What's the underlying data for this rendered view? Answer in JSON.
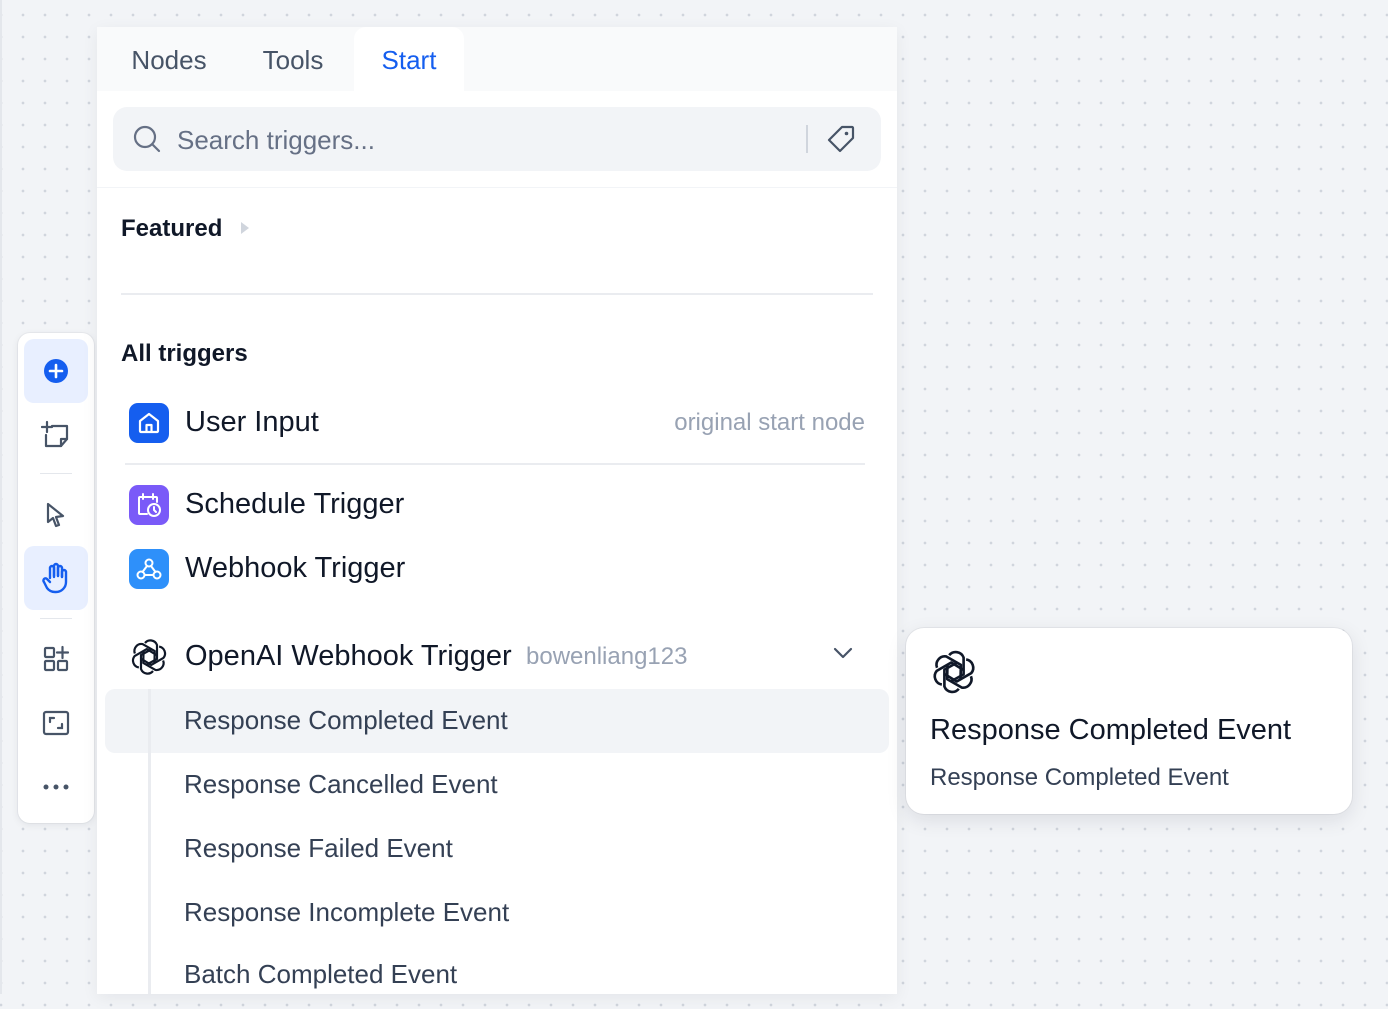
{
  "tabs": [
    {
      "label": "Nodes",
      "active": false
    },
    {
      "label": "Tools",
      "active": false
    },
    {
      "label": "Start",
      "active": true
    }
  ],
  "search": {
    "placeholder": "Search triggers..."
  },
  "featured": {
    "title": "Featured"
  },
  "all_triggers": {
    "title": "All triggers",
    "items": [
      {
        "label": "User Input",
        "note": "original start node",
        "icon": "home-icon",
        "color": "#155eef"
      },
      {
        "label": "Schedule Trigger",
        "icon": "calendar-clock-icon",
        "color": "#7a5af8"
      },
      {
        "label": "Webhook Trigger",
        "icon": "webhook-icon",
        "color": "#2e90fa"
      }
    ]
  },
  "plugin": {
    "label": "OpenAI Webhook Trigger",
    "author": "bowenliang123",
    "icon": "openai-icon",
    "expanded": true,
    "events": [
      {
        "label": "Response Completed Event",
        "hover": true
      },
      {
        "label": "Response Cancelled Event"
      },
      {
        "label": "Response Failed Event"
      },
      {
        "label": "Response Incomplete Event"
      },
      {
        "label": "Batch Completed Event"
      }
    ]
  },
  "tooltip": {
    "title": "Response Completed Event",
    "description": "Response Completed Event",
    "icon": "openai-icon"
  },
  "toolbar": {
    "items": [
      "add-node-icon",
      "add-note-icon",
      "pointer-icon",
      "hand-icon",
      "organize-icon",
      "fit-view-icon",
      "more-icon"
    ],
    "active": [
      "add-node-icon",
      "hand-icon"
    ],
    "accent": "#155eef"
  }
}
